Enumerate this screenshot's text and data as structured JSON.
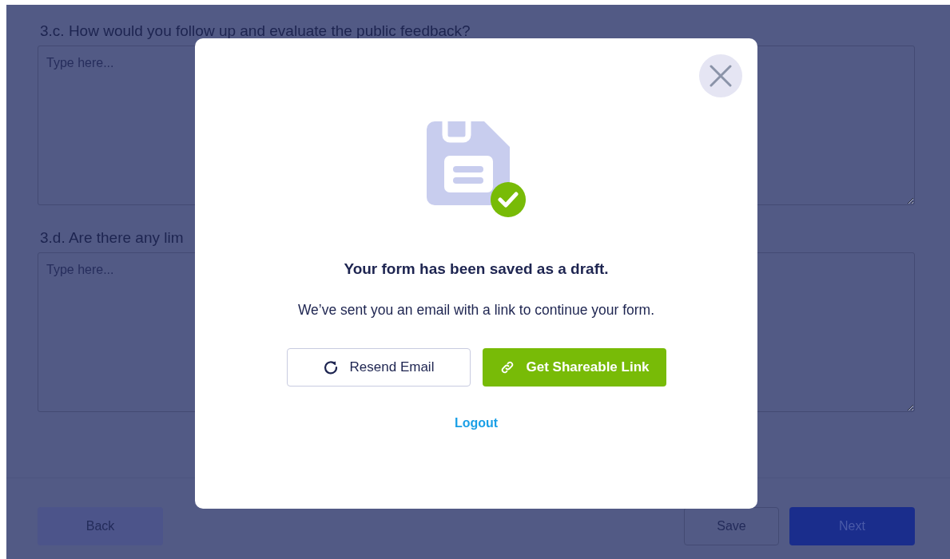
{
  "form": {
    "questions": [
      {
        "label": "3.c. How would you follow up and evaluate the public feedback?",
        "placeholder": "Type here..."
      },
      {
        "label": "3.d. Are there any lim",
        "placeholder": "Type here..."
      }
    ],
    "nav": {
      "back": "Back",
      "save": "Save",
      "next": "Next"
    }
  },
  "modal": {
    "title": "Your form has been saved as a draft.",
    "message": "We’ve sent you an email with a link to continue your form.",
    "buttons": [
      {
        "kind": "outline",
        "label": "Resend Email"
      },
      {
        "kind": "primary",
        "label": "Get Shareable Link"
      }
    ],
    "link": "Logout"
  }
}
